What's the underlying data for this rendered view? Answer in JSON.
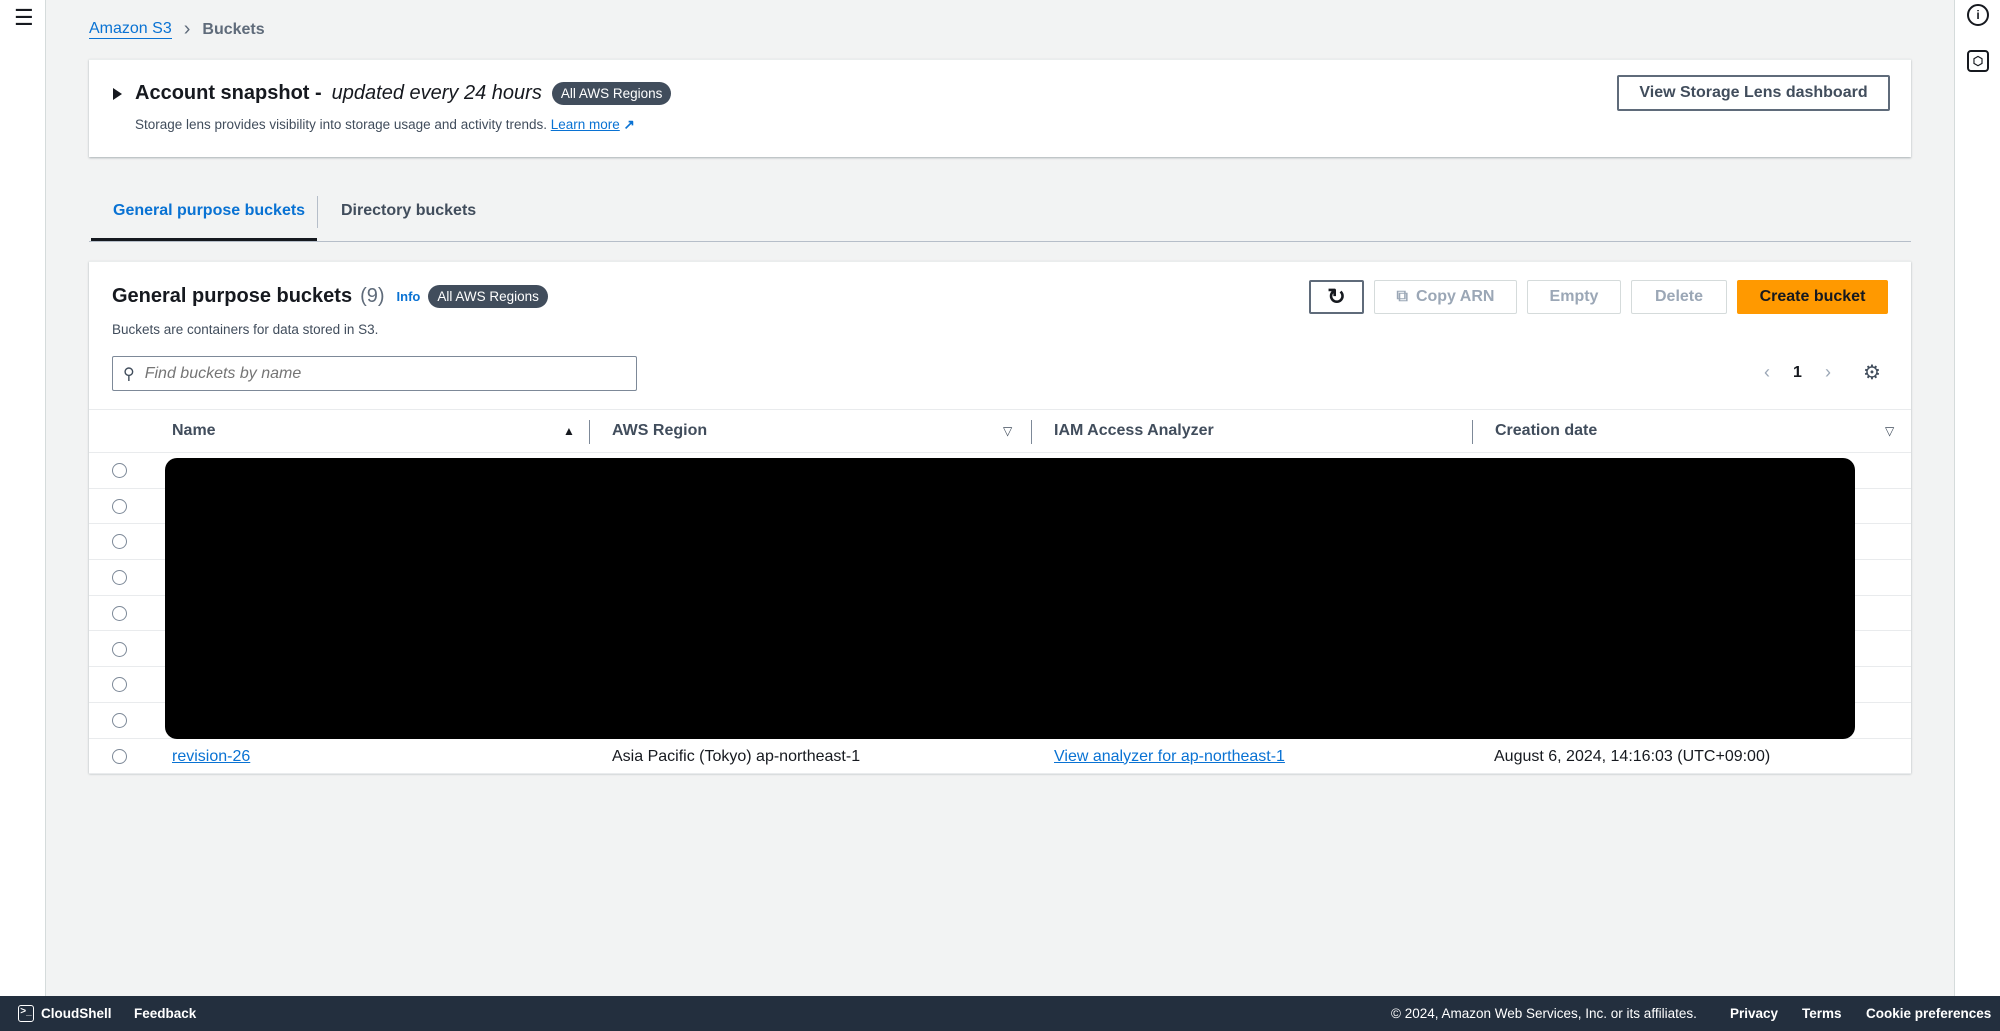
{
  "breadcrumb": {
    "root": "Amazon S3",
    "current": "Buckets"
  },
  "snapshot": {
    "title": "Account snapshot -",
    "title_italic": "updated every 24 hours",
    "badge": "All AWS Regions",
    "description": "Storage lens provides visibility into storage usage and activity trends.",
    "learn_more": "Learn more",
    "button": "View Storage Lens dashboard"
  },
  "tabs": [
    {
      "label": "General purpose buckets",
      "active": true
    },
    {
      "label": "Directory buckets",
      "active": false
    }
  ],
  "panel": {
    "title": "General purpose buckets",
    "count": "(9)",
    "info": "Info",
    "badge": "All AWS Regions",
    "description": "Buckets are containers for data stored in S3.",
    "buttons": {
      "copy_arn": "Copy ARN",
      "empty": "Empty",
      "delete": "Delete",
      "create": "Create bucket"
    },
    "search_placeholder": "Find buckets by name",
    "page": "1",
    "columns": [
      "Name",
      "AWS Region",
      "IAM Access Analyzer",
      "Creation date"
    ],
    "rows": [
      {
        "name": "revision-26",
        "region": "Asia Pacific (Tokyo) ap-northeast-1",
        "analyzer": "View analyzer for ap-northeast-1",
        "created": "August 6, 2024, 14:16:03 (UTC+09:00)"
      }
    ]
  },
  "footer": {
    "cloudshell": "CloudShell",
    "feedback": "Feedback",
    "copyright": "© 2024, Amazon Web Services, Inc. or its affiliates.",
    "privacy": "Privacy",
    "terms": "Terms",
    "cookies": "Cookie preferences"
  },
  "colors": {
    "accent": "#0972d3",
    "primary_button": "#ff9900",
    "footer": "#232f3e"
  }
}
